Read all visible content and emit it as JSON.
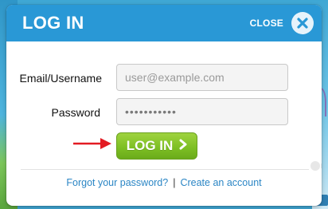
{
  "dialog": {
    "title": "LOG IN",
    "close_label": "CLOSE",
    "close_icon": "close-icon"
  },
  "form": {
    "email_label": "Email/Username",
    "email_placeholder": "user@example.com",
    "password_label": "Password",
    "password_value": "•••••••••••",
    "submit_label": "LOG IN",
    "submit_icon": "chevron-right-icon"
  },
  "footer": {
    "forgot_link": "Forgot your password?",
    "separator": "|",
    "create_link": "Create an account"
  },
  "colors": {
    "header": "#2998d6",
    "button": "#7ec024",
    "link": "#2b86c5",
    "arrow": "#e31b23"
  }
}
